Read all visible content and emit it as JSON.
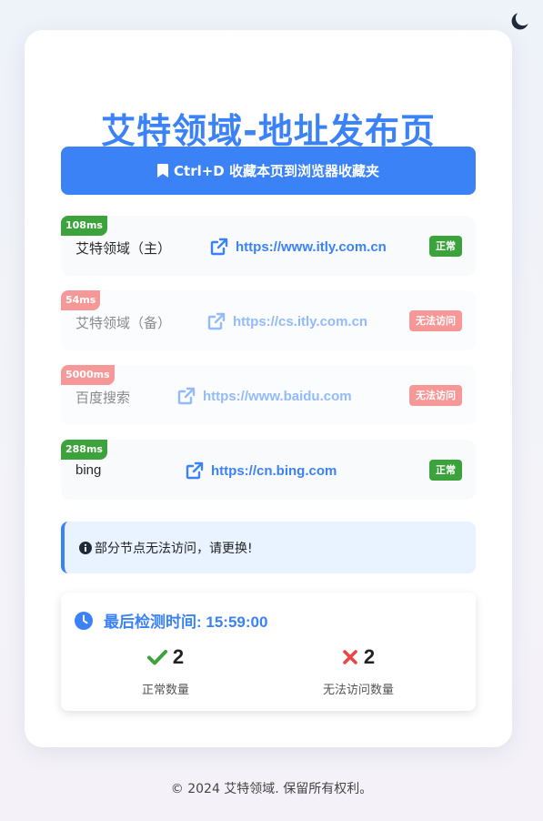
{
  "page": {
    "title": "艾特领域-地址发布页",
    "bookmark_label": "Ctrl+D 收藏本页到浏览器收藏夹"
  },
  "links": [
    {
      "latency": "108ms",
      "name": "艾特领域（主）",
      "url": "https://www.itly.com.cn",
      "status": "正常",
      "state": "ok"
    },
    {
      "latency": "54ms",
      "name": "艾特领域（备）",
      "url": "https://cs.itly.com.cn",
      "status": "无法访问",
      "state": "bad"
    },
    {
      "latency": "5000ms",
      "name": "百度搜索",
      "url": "https://www.baidu.com",
      "status": "无法访问",
      "state": "bad"
    },
    {
      "latency": "288ms",
      "name": "bing",
      "url": "https://cn.bing.com",
      "status": "正常",
      "state": "ok"
    }
  ],
  "alert": {
    "text": "部分节点无法访问，请更换!"
  },
  "check": {
    "title": "最后检测时间: 15:59:00",
    "ok_count": "2",
    "ok_label": "正常数量",
    "bad_count": "2",
    "bad_label": "无法访问数量"
  },
  "footer": {
    "text": "© 2024 艾特领域. 保留所有权利。"
  },
  "icons": {
    "theme_toggle": "moon-icon",
    "bookmark": "bookmark-icon",
    "link": "external-link-icon",
    "alert": "info-circle-icon",
    "clock": "clock-icon",
    "ok": "check-icon",
    "bad": "x-icon"
  },
  "colors": {
    "accent": "#3b82f6",
    "ok": "#3ca23c",
    "bad": "#ef4444",
    "alert_bg": "#e8f3ff"
  }
}
